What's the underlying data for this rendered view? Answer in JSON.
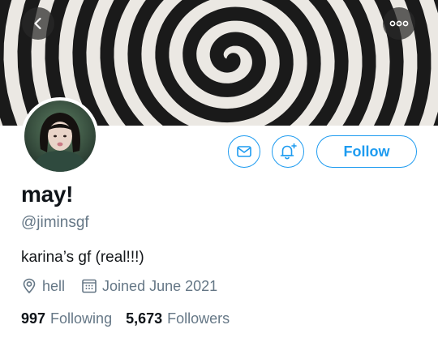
{
  "header": {
    "back_icon": "chevron-left-icon",
    "more_icon": "more-horizontal-icon",
    "banner_description_icon": "spiral-banner"
  },
  "actions": {
    "message_icon": "mail-icon",
    "notify_icon": "bell-plus-icon",
    "follow_label": "Follow"
  },
  "profile": {
    "display_name": "may!",
    "handle": "@jiminsgf",
    "bio": "karina’s gf (real!!!)",
    "location": "hell",
    "joined": "Joined June 2021"
  },
  "stats": {
    "following_count": "997",
    "following_label": "Following",
    "followers_count": "5,673",
    "followers_label": "Followers"
  },
  "colors": {
    "accent": "#1d9bf0",
    "muted_text": "#657786"
  }
}
